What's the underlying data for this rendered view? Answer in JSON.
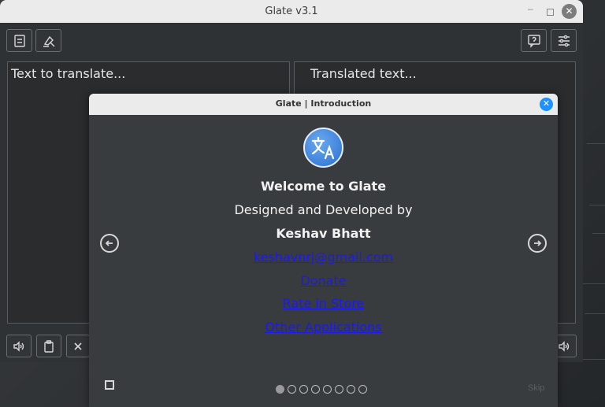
{
  "main_window": {
    "title": "Glate v3.1",
    "win_controls": {
      "minimize": "–",
      "close": "✕"
    },
    "toolbar": {
      "left_icons": [
        "save-icon",
        "clear-format-icon"
      ],
      "right_icons": [
        "help-icon",
        "settings-icon"
      ]
    },
    "source_pane": {
      "placeholder": "Text to translate..."
    },
    "target_pane": {
      "placeholder": "Translated text..."
    },
    "bottom_icons": [
      "speaker-icon",
      "clipboard-icon",
      "clear-icon"
    ]
  },
  "dialog": {
    "title": "Glate | Introduction",
    "close_label": "✕",
    "welcome": "Welcome to Glate",
    "designed_by": "Designed and Developed by",
    "author": "Keshav Bhatt",
    "email": "keshavnrj@gmail.com",
    "donate": "Donate",
    "rate": "Rate in Store",
    "other_apps": "Other Applications",
    "skip": "Skip",
    "pagination": {
      "total": 8,
      "active": 1
    }
  },
  "colors": {
    "accent": "#1e90ff",
    "link": "#1a1aee",
    "dialog_bg": "#393c3e",
    "window_bg": "#2f3234"
  }
}
